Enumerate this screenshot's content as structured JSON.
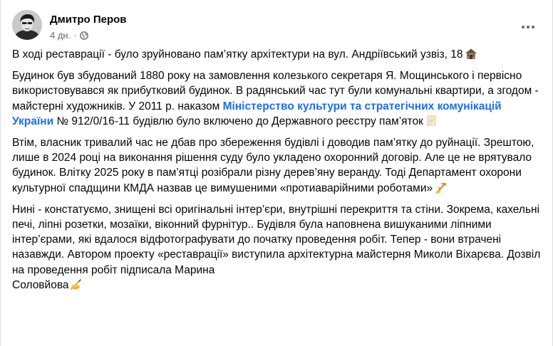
{
  "post": {
    "author": "Дмитро Перов",
    "time": "4 дн.",
    "separator": "·",
    "more_label": "•••",
    "paragraph1": "В ході реставрації - було зруйновано пам’ятку архітектури на вул. Андріївський узвіз, 18",
    "paragraph2_part1": "Будинок був збудований 1880 року на замовлення колезького секретаря Я. Мощинського і первісно використовувався як прибутковий будинок. В радянський час тут були комунальні квартири, а згодом - майстерні художників. У 2011 р. наказом ",
    "paragraph2_link": "Міністерство культури та стратегічних комунікацій України",
    "paragraph2_part2": " № 912/0/16-11 будівлю було включено до Державного реєстру пам’яток",
    "paragraph3": "Втім, власник тривалий час не дбав про збереження будівлі і доводив пам’ятку до руйнації. Зрештою, лише в 2024 році на виконання рішення суду було укладено охоронний договір. Але це не врятувало будинок. Влітку 2025 року в пам’ятці розібрали різну дерев’яну веранду. Тоді Департамент охорони культурної спадщини КМДА назвав це вимушеними «протиаварійними роботами»",
    "paragraph4_part1": "Нині - констатуємо, знищені всі оригінальні інтер’єри, внутрішні перекриття та стіни. Зокрема, кахельні печі, ліпні розетки, мозаїки, віконний фурнітур.. Будівля була наповнена вишуканими ліпними інтер’єрами, які вдалося відфотографувати до початку проведення робіт. Тепер - вони втрачені назавжди. Автором проекту «реставрації» виступила архітектурна майстерня Миколи Віхарєва. Дозвіл на проведення робіт підписала Марина",
    "paragraph4_part2": "Соловйова"
  },
  "icons": {
    "house": "derelict-house-emoji",
    "scroll": "scroll-emoji",
    "construction": "construction-emoji",
    "writing": "writing-hand-emoji",
    "globe": "globe-icon",
    "more": "more-options-icon"
  },
  "colors": {
    "link": "#216fdb",
    "text": "#050505",
    "meta": "#65676b"
  }
}
